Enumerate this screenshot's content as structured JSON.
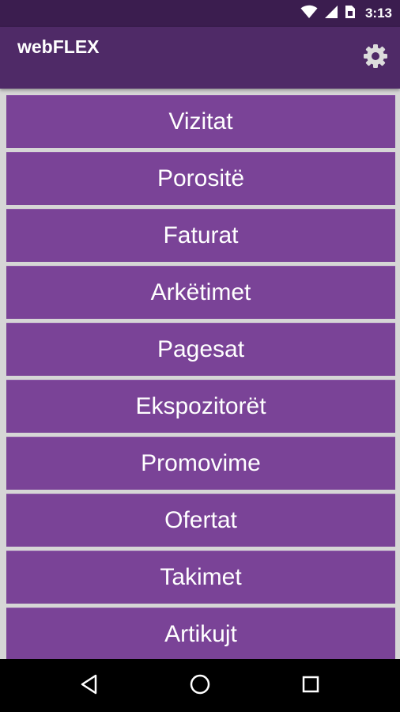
{
  "status_bar": {
    "time": "3:13",
    "icons": [
      "wifi-icon",
      "cellular-signal-icon",
      "sim-card-icon"
    ]
  },
  "app_bar": {
    "title": "webFLEX",
    "settings_icon": "gear-icon"
  },
  "menu": {
    "items": [
      {
        "label": "Vizitat"
      },
      {
        "label": "Porositë"
      },
      {
        "label": "Faturat"
      },
      {
        "label": "Arkëtimet"
      },
      {
        "label": "Pagesat"
      },
      {
        "label": "Ekspozitorët"
      },
      {
        "label": "Promovime"
      },
      {
        "label": "Ofertat"
      },
      {
        "label": "Takimet"
      },
      {
        "label": "Artikujt"
      }
    ]
  },
  "nav_bar": {
    "icons": [
      "back-icon",
      "home-icon",
      "recents-icon"
    ]
  },
  "colors": {
    "status_bar": "#3b1d4f",
    "app_bar": "#4f2a67",
    "menu_item": "#7a4397",
    "background": "#d6d6d6",
    "nav_bar": "#000000"
  }
}
